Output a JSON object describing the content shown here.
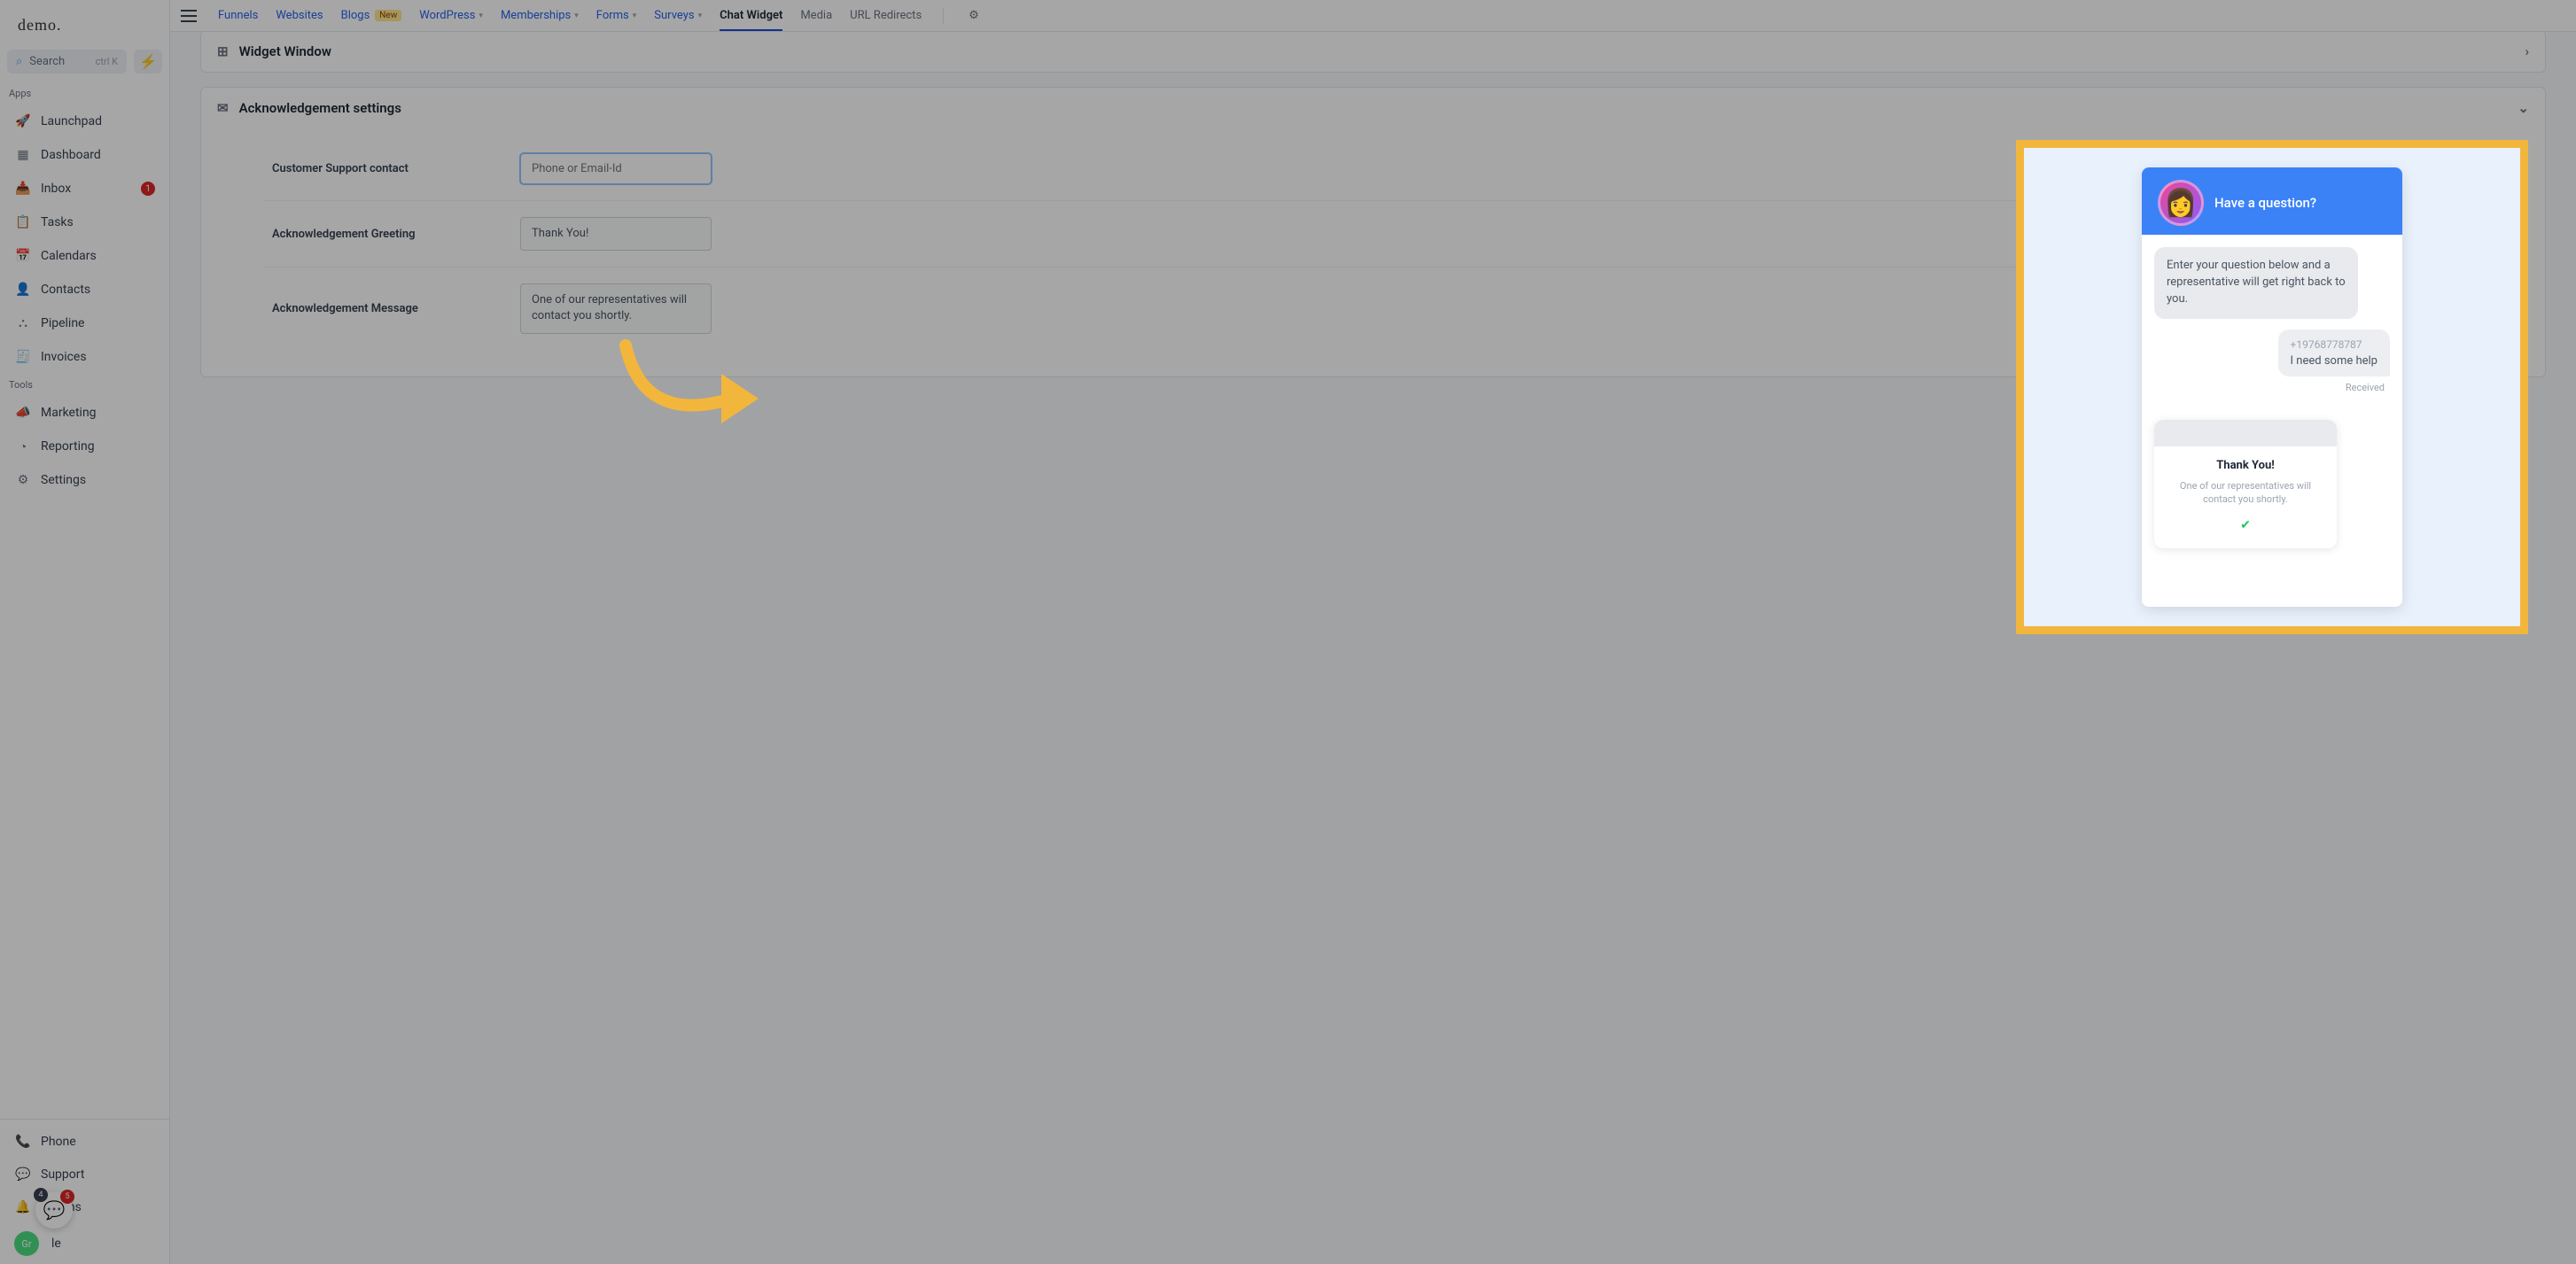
{
  "brand": "demo.",
  "search": {
    "label": "Search",
    "shortcut": "ctrl K"
  },
  "sidebar": {
    "apps_label": "Apps",
    "tools_label": "Tools",
    "items": [
      {
        "label": "Launchpad",
        "icon": "🚀"
      },
      {
        "label": "Dashboard",
        "icon": "▦"
      },
      {
        "label": "Inbox",
        "icon": "📥",
        "badge": "1"
      },
      {
        "label": "Tasks",
        "icon": "📋"
      },
      {
        "label": "Calendars",
        "icon": "📅"
      },
      {
        "label": "Contacts",
        "icon": "👤"
      },
      {
        "label": "Pipeline",
        "icon": "⛬"
      },
      {
        "label": "Invoices",
        "icon": "🧾"
      }
    ],
    "tools": [
      {
        "label": "Marketing",
        "icon": "📣"
      },
      {
        "label": "Reporting",
        "icon": "◔"
      },
      {
        "label": "Settings",
        "icon": "⚙"
      }
    ],
    "bottom": [
      {
        "label": "Phone",
        "icon": "📞"
      },
      {
        "label": "Support",
        "icon": "💬"
      },
      {
        "label": "cations",
        "icon": "🔔"
      },
      {
        "label": "le",
        "avatar": "Gr"
      }
    ]
  },
  "float": {
    "b1": "4",
    "b2": "5"
  },
  "topnav": {
    "items": [
      {
        "label": "Funnels"
      },
      {
        "label": "Websites"
      },
      {
        "label": "Blogs",
        "new": "New"
      },
      {
        "label": "WordPress",
        "dd": true
      },
      {
        "label": "Memberships",
        "dd": true
      },
      {
        "label": "Forms",
        "dd": true
      },
      {
        "label": "Surveys",
        "dd": true
      },
      {
        "label": "Chat Widget",
        "active": true
      },
      {
        "label": "Media",
        "plain": true
      },
      {
        "label": "URL Redirects",
        "plain": true
      }
    ]
  },
  "panels": {
    "widget_window": "Widget Window",
    "ack_settings": "Acknowledgement settings"
  },
  "form": {
    "contact_label": "Customer Support contact",
    "contact_placeholder": "Phone or Email-Id",
    "greeting_label": "Acknowledgement Greeting",
    "greeting_value": "Thank You!",
    "message_label": "Acknowledgement Message",
    "message_value": "One of our representatives will contact you shortly."
  },
  "preview": {
    "header": "Have a question?",
    "intro": "Enter your question below and a representative will get right back to you.",
    "phone": "+19768778787",
    "user_msg": "I need some help",
    "received": "Received",
    "thanks_title": "Thank You!",
    "thanks_desc": "One of our representatives will contact you shortly."
  }
}
